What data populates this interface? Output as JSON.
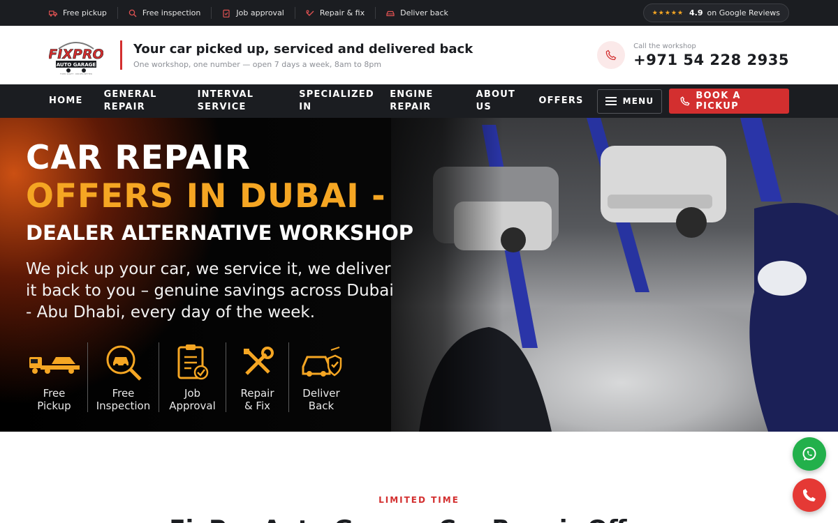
{
  "topbar": {
    "steps": [
      {
        "label": "Free pickup",
        "icon": "truck-icon"
      },
      {
        "label": "Free inspection",
        "icon": "search-icon"
      },
      {
        "label": "Job approval",
        "icon": "clipboard-icon"
      },
      {
        "label": "Repair & fix",
        "icon": "wrench-icon"
      },
      {
        "label": "Deliver back",
        "icon": "car-check-icon"
      }
    ],
    "rating": {
      "stars": "★★★★★",
      "score": "4.9",
      "label": "on Google Reviews"
    }
  },
  "header": {
    "logo_alt": "FIXPRO AUTO GARAGE",
    "title": "Your car picked up, serviced and delivered back",
    "subtitle": "One workshop, one number — open 7 days a week, 8am to 8pm",
    "call_label": "Call the workshop",
    "call_number": "+971 54 228 2935"
  },
  "nav": {
    "items": [
      "HOME",
      "GENERAL REPAIR",
      "INTERVAL SERVICE",
      "SPECIALIZED IN",
      "ENGINE REPAIR",
      "ABOUT US",
      "OFFERS"
    ],
    "menu_label": "MENU",
    "book_label": "BOOK A PICKUP"
  },
  "hero": {
    "line1": "CAR REPAIR",
    "line2": "OFFERS IN DUBAI -",
    "line3": "DEALER ALTERNATIVE WORKSHOP",
    "description": "We pick up your car, we service it, we deliver it back to you – genuine savings across Dubai - Abu Dhabi, every day of the week.",
    "steps": [
      {
        "line1": "Free",
        "line2": "Pickup",
        "icon": "tow-truck-icon"
      },
      {
        "line1": "Free",
        "line2": "Inspection",
        "icon": "magnifier-car-icon"
      },
      {
        "line1": "Job",
        "line2": "Approval",
        "icon": "checklist-icon"
      },
      {
        "line1": "Repair",
        "line2": "& Fix",
        "icon": "tools-icon"
      },
      {
        "line1": "Deliver",
        "line2": "Back",
        "icon": "car-shield-icon"
      }
    ]
  },
  "section": {
    "eyebrow": "LIMITED TIME",
    "title": "FixPro Auto Garage Car Repair Offers"
  },
  "colors": {
    "accent": "#d32f2f",
    "dark": "#1b1d21",
    "orange": "#f5a623",
    "whatsapp": "#22b04b"
  }
}
